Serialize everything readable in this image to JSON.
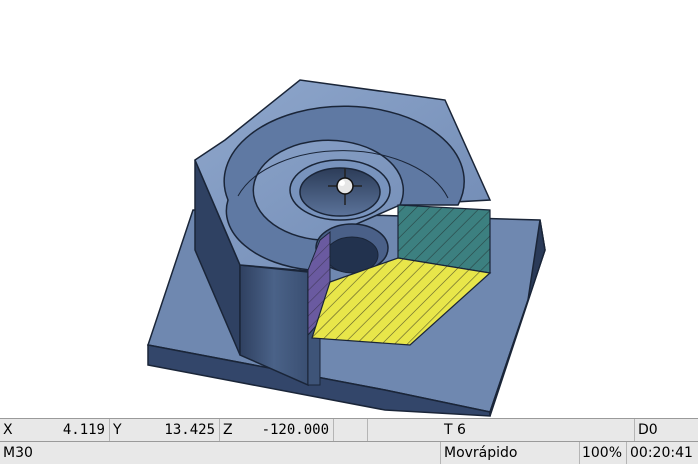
{
  "coords": {
    "x_label": "X",
    "x_value": "4.119",
    "y_label": "Y",
    "y_value": "13.425",
    "z_label": "Z",
    "z_value": "-120.000"
  },
  "tool": {
    "tool": "T 6",
    "offset": "D0"
  },
  "program": {
    "mcode": "M30",
    "mode": "Movrápido",
    "feed_override": "100%",
    "time": "00:20:41"
  },
  "colors": {
    "background": "#ffffff",
    "part_top": "#7f9ac4",
    "part_side": "#3f5476",
    "part_edge": "#1a2538",
    "section_yellow": "#e8e64a",
    "section_teal": "#3c8080",
    "section_purple": "#6a5aa0",
    "statusbar": "#e8e8e8"
  }
}
